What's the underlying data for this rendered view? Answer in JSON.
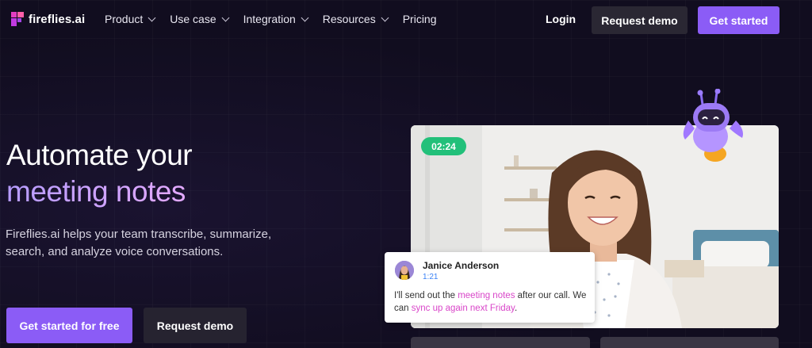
{
  "nav": {
    "brand": "fireflies.ai",
    "items": [
      {
        "label": "Product",
        "has_dropdown": true
      },
      {
        "label": "Use case",
        "has_dropdown": true
      },
      {
        "label": "Integration",
        "has_dropdown": true
      },
      {
        "label": "Resources",
        "has_dropdown": true
      },
      {
        "label": "Pricing",
        "has_dropdown": false
      }
    ],
    "login": "Login",
    "request_demo": "Request demo",
    "get_started": "Get started"
  },
  "hero": {
    "title_line1": "Automate your",
    "title_line2": "meeting notes",
    "subtitle": "Fireflies.ai helps your team transcribe, summarize, search, and analyze voice conversations.",
    "cta_primary": "Get started for free",
    "cta_secondary": "Request demo"
  },
  "video": {
    "timer": "02:24"
  },
  "chat": {
    "name": "Janice Anderson",
    "time": "1:21",
    "text_before": "I'll send out the ",
    "highlight1": "meeting notes",
    "text_middle": " after our call. We can ",
    "highlight2": "sync up again next Friday",
    "text_after": "."
  },
  "colors": {
    "background": "#110d1f",
    "accent_purple": "#8b5cf6",
    "timer_green": "#22c07a",
    "highlight_pink": "#d946c9"
  }
}
